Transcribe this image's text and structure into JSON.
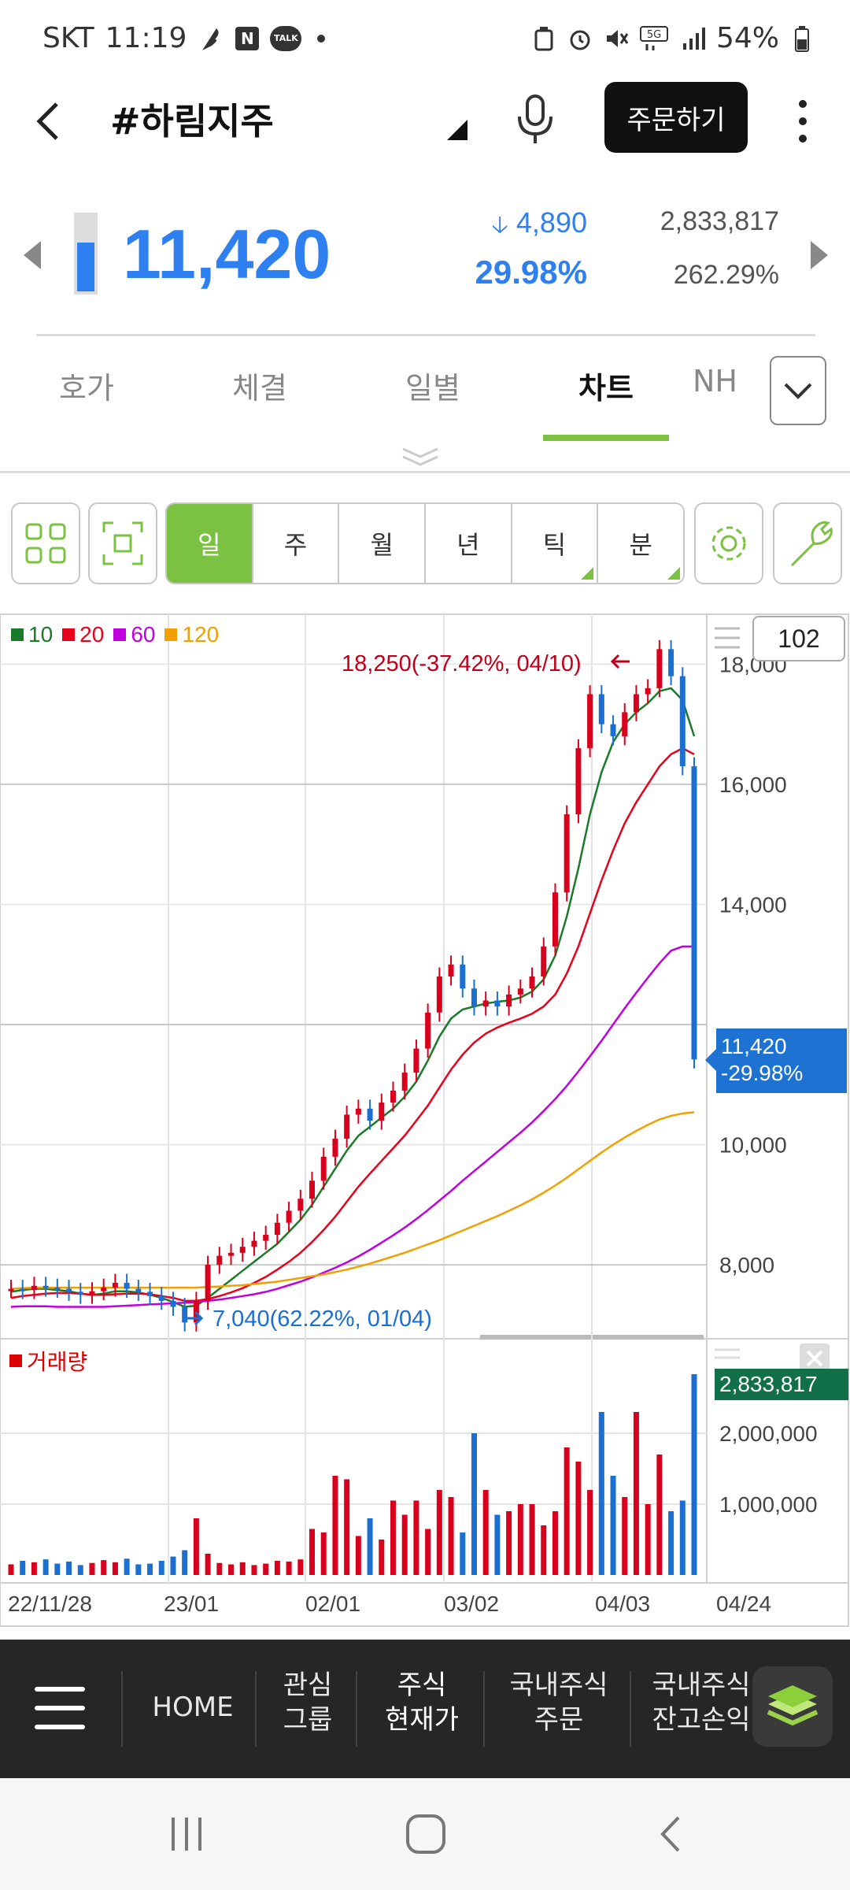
{
  "status_bar": {
    "carrier": "SKT",
    "time": "11:19",
    "battery": "54%",
    "network": "5G",
    "app_badges": [
      "N",
      "TALK"
    ]
  },
  "header": {
    "title": "#하림지주",
    "order_button": "주문하기",
    "icons": [
      "back-icon",
      "dropdown-icon",
      "mic-icon",
      "more-icon"
    ]
  },
  "quote": {
    "price": "11,420",
    "change": "4,890",
    "change_pct": "29.98%",
    "volume": "2,833,817",
    "volume_ratio": "262.29%",
    "gauge_fill_fraction": 0.65,
    "color": "#2e7ff0"
  },
  "tabs": [
    {
      "label": "호가"
    },
    {
      "label": "체결"
    },
    {
      "label": "일별"
    },
    {
      "label": "차트",
      "active": true
    },
    {
      "label": "NH"
    }
  ],
  "toolbar": {
    "periods": [
      "일",
      "주",
      "월",
      "년",
      "틱",
      "분"
    ],
    "active_period": "일",
    "accent": "#7cc242"
  },
  "chart": {
    "candle_count": "102",
    "legend": [
      {
        "label": "10",
        "color": "#1a7a2a"
      },
      {
        "label": "20",
        "color": "#e8001c"
      },
      {
        "label": "60",
        "color": "#c000e0"
      },
      {
        "label": "120",
        "color": "#f0a000"
      }
    ],
    "high_annotation": "18,250(-37.42%, 04/10)",
    "low_annotation": "7,040(62.22%, 01/04)",
    "current_price_label": "11,420",
    "current_change_label": "-29.98%",
    "volume_title": "거래량",
    "volume_current_label": "2,833,817",
    "price_axis_labels": [
      "18,000",
      "16,000",
      "14,000",
      "10,000",
      "8,000"
    ],
    "volume_axis_labels": [
      "2,000,000",
      "1,000,000"
    ],
    "date_labels": [
      "22/11/28",
      "23/01",
      "02/01",
      "03/02",
      "04/03",
      "04/24"
    ]
  },
  "chart_data": {
    "type": "line",
    "title": "",
    "price_axis": {
      "ticks": [
        8000,
        10000,
        12000,
        14000,
        16000,
        18000
      ],
      "range": [
        6900,
        18700
      ]
    },
    "volume_axis": {
      "ticks": [
        1000000,
        2000000
      ],
      "range": [
        0,
        3000000
      ]
    },
    "x": [
      "22/11/28",
      "23/01",
      "02/01",
      "03/02",
      "04/03",
      "04/24"
    ],
    "close": [
      7600,
      7580,
      7650,
      7620,
      7600,
      7550,
      7500,
      7560,
      7620,
      7700,
      7600,
      7550,
      7480,
      7400,
      7300,
      7040,
      7400,
      8000,
      8150,
      8200,
      8300,
      8400,
      8500,
      8700,
      8900,
      9100,
      9400,
      9800,
      10100,
      10500,
      10600,
      10400,
      10700,
      10900,
      11200,
      11600,
      12200,
      12800,
      13000,
      12600,
      12300,
      12400,
      12300,
      12500,
      12600,
      12800,
      13300,
      14200,
      15500,
      16600,
      17500,
      17000,
      16800,
      17200,
      17500,
      17600,
      18250,
      17800,
      16300,
      11420
    ],
    "series": [
      {
        "name": "10",
        "values": [
          7550,
          7580,
          7600,
          7600,
          7580,
          7560,
          7520,
          7500,
          7520,
          7560,
          7560,
          7540,
          7500,
          7450,
          7380,
          7300,
          7320,
          7450,
          7600,
          7750,
          7900,
          8050,
          8200,
          8350,
          8550,
          8750,
          9000,
          9300,
          9600,
          9900,
          10150,
          10300,
          10450,
          10600,
          10800,
          11050,
          11400,
          11800,
          12100,
          12250,
          12300,
          12350,
          12380,
          12400,
          12450,
          12550,
          12750,
          13150,
          13800,
          14600,
          15500,
          16200,
          16700,
          17000,
          17200,
          17350,
          17550,
          17600,
          17400,
          16800
        ]
      },
      {
        "name": "20",
        "values": [
          7450,
          7480,
          7500,
          7520,
          7530,
          7530,
          7520,
          7500,
          7500,
          7510,
          7520,
          7520,
          7510,
          7480,
          7450,
          7400,
          7400,
          7430,
          7480,
          7540,
          7610,
          7700,
          7800,
          7920,
          8050,
          8200,
          8380,
          8580,
          8800,
          9050,
          9300,
          9520,
          9730,
          9940,
          10150,
          10400,
          10650,
          10950,
          11250,
          11500,
          11700,
          11850,
          11950,
          12030,
          12100,
          12180,
          12300,
          12500,
          12850,
          13300,
          13850,
          14400,
          14900,
          15350,
          15700,
          16000,
          16300,
          16500,
          16600,
          16500
        ]
      },
      {
        "name": "60",
        "values": [
          7300,
          7310,
          7310,
          7310,
          7300,
          7300,
          7300,
          7300,
          7300,
          7310,
          7320,
          7330,
          7340,
          7350,
          7360,
          7370,
          7380,
          7400,
          7420,
          7450,
          7480,
          7510,
          7550,
          7600,
          7660,
          7720,
          7790,
          7870,
          7950,
          8040,
          8140,
          8250,
          8370,
          8490,
          8620,
          8760,
          8910,
          9070,
          9230,
          9400,
          9560,
          9720,
          9880,
          10040,
          10200,
          10370,
          10560,
          10760,
          10980,
          11220,
          11470,
          11730,
          12000,
          12270,
          12530,
          12780,
          13020,
          13230,
          13300,
          13300
        ]
      },
      {
        "name": "120",
        "values": [
          7600,
          7610,
          7620,
          7620,
          7620,
          7620,
          7620,
          7620,
          7620,
          7620,
          7620,
          7620,
          7620,
          7620,
          7620,
          7620,
          7620,
          7630,
          7640,
          7650,
          7660,
          7680,
          7700,
          7720,
          7750,
          7780,
          7810,
          7840,
          7880,
          7920,
          7970,
          8020,
          8080,
          8140,
          8200,
          8270,
          8340,
          8410,
          8490,
          8570,
          8650,
          8730,
          8810,
          8900,
          8990,
          9090,
          9200,
          9320,
          9450,
          9590,
          9730,
          9870,
          10000,
          10120,
          10230,
          10330,
          10420,
          10480,
          10520,
          10540
        ]
      }
    ],
    "volume": [
      150000,
      200000,
      180000,
      220000,
      160000,
      190000,
      140000,
      170000,
      210000,
      180000,
      230000,
      150000,
      160000,
      200000,
      260000,
      350000,
      800000,
      300000,
      170000,
      150000,
      180000,
      140000,
      160000,
      200000,
      190000,
      220000,
      650000,
      600000,
      1400000,
      1350000,
      550000,
      800000,
      500000,
      1050000,
      850000,
      1050000,
      650000,
      1200000,
      1100000,
      600000,
      2000000,
      1200000,
      850000,
      900000,
      1000000,
      1000000,
      700000,
      900000,
      1800000,
      1600000,
      1200000,
      2300000,
      1400000,
      1100000,
      2300000,
      1000000,
      1700000,
      900000,
      1050000,
      2833817
    ],
    "legend_position": "top-left",
    "grid": true
  },
  "bottom_nav": {
    "items": [
      {
        "label": "HOME"
      },
      {
        "label": "관심\n그룹"
      },
      {
        "label": "주식\n현재가",
        "active": true
      },
      {
        "label": "국내주식\n주문"
      },
      {
        "label": "국내주식\n잔고손익"
      }
    ]
  }
}
